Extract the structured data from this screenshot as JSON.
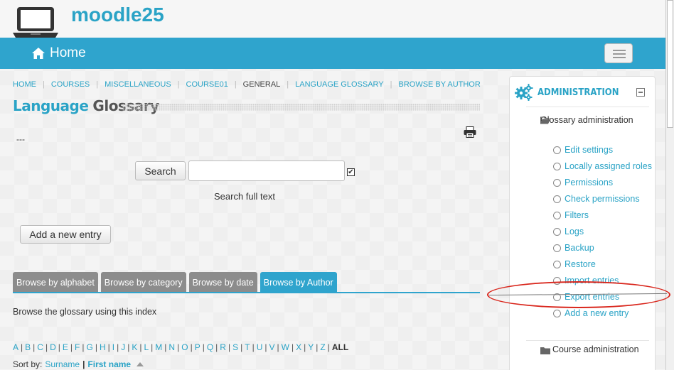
{
  "site": {
    "name": "moodle25",
    "icon": "laptop-icon"
  },
  "navbar": {
    "home_label": "Home",
    "home_icon": "home-icon",
    "toggle_icon": "menu-icon"
  },
  "breadcrumb": {
    "items": [
      "HOME",
      "COURSES",
      "MISCELLANEOUS",
      "COURSE01",
      "GENERAL",
      "LANGUAGE GLOSSARY",
      "BROWSE BY AUTHOR"
    ]
  },
  "page": {
    "title_part1": "Language",
    "title_part2": "Glossary",
    "intro": "---"
  },
  "search": {
    "button_label": "Search",
    "input_value": "",
    "fulltext_checked": true,
    "fulltext_label": "Search full text"
  },
  "add_entry_label": "Add a new entry",
  "tabs": {
    "alphabet": "Browse by alphabet",
    "category": "Browse by category",
    "date": "Browse by date",
    "author": "Browse by Author",
    "active": "author"
  },
  "browse_info": "Browse the glossary using this index",
  "alphabet": {
    "letters": [
      "A",
      "B",
      "C",
      "D",
      "E",
      "F",
      "G",
      "H",
      "I",
      "J",
      "K",
      "L",
      "M",
      "N",
      "O",
      "P",
      "Q",
      "R",
      "S",
      "T",
      "U",
      "V",
      "W",
      "X",
      "Y",
      "Z"
    ],
    "all": "ALL"
  },
  "sort": {
    "prefix": "Sort by:",
    "surname": "Surname",
    "separator": "|",
    "firstname": "First name"
  },
  "administration": {
    "title": "ADMINISTRATION",
    "glossary_admin": "Glossary administration",
    "items": {
      "edit_settings": "Edit settings",
      "locally_assigned": "Locally assigned roles",
      "permissions": "Permissions",
      "check_permissions": "Check permissions",
      "filters": "Filters",
      "logs": "Logs",
      "backup": "Backup",
      "restore": "Restore",
      "import_entries": "Import entries",
      "export_entries": "Export entries",
      "add_new_entry": "Add a new entry"
    },
    "course_admin": "Course administration"
  },
  "colors": {
    "accent": "#2fa4cd",
    "annotation": "#d9261c"
  }
}
